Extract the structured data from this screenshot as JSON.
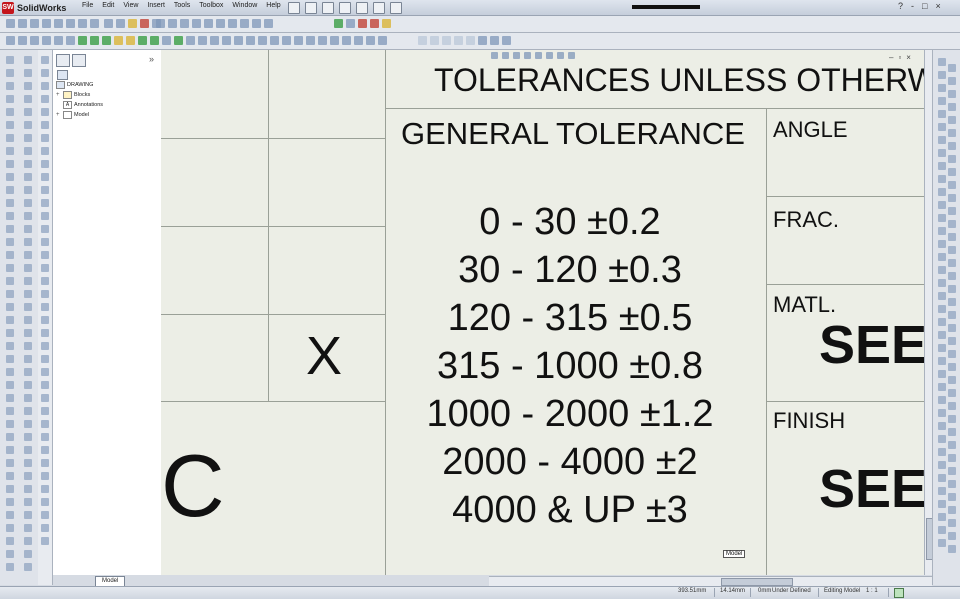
{
  "app": {
    "name": "SolidWorks",
    "logo_text": "SW",
    "menus": [
      "File",
      "Edit",
      "View",
      "Insert",
      "Tools",
      "Toolbox",
      "Window",
      "Help"
    ],
    "window_controls": [
      "?",
      "-",
      "□",
      "×"
    ]
  },
  "feature_tree": {
    "root": "DRAWING",
    "items": [
      {
        "label": "Blocks"
      },
      {
        "label": "Annotations"
      },
      {
        "label": "Model"
      }
    ],
    "collapse": "»",
    "tab": "Model"
  },
  "drawing": {
    "header": "TOLERANCES UNLESS OTHERWISE S",
    "general": "GENERAL TOLERANCE",
    "tolerances": [
      "0 - 30 ±0.2",
      "30 - 120 ±0.3",
      "120 - 315 ±0.5",
      "315 - 1000 ±0.8",
      "1000 - 2000 ±1.2",
      "2000 - 4000 ±2",
      "4000 & UP ±3"
    ],
    "angle": "ANGLE",
    "frac": "FRAC.",
    "matl": "MATL.",
    "finish": "FINISH",
    "see1": "SEE I",
    "see2": "SEE I",
    "x_mark": "X",
    "c_mark": "C",
    "model_label": "Model",
    "doc_controls": [
      "–",
      "▫",
      "×"
    ]
  },
  "status": {
    "coords": "393.51mm",
    "coord2": "14.14mm",
    "coord3": "0mm",
    "defined": "Under Defined",
    "editing": "Editing Model",
    "scale": "1 : 1"
  }
}
